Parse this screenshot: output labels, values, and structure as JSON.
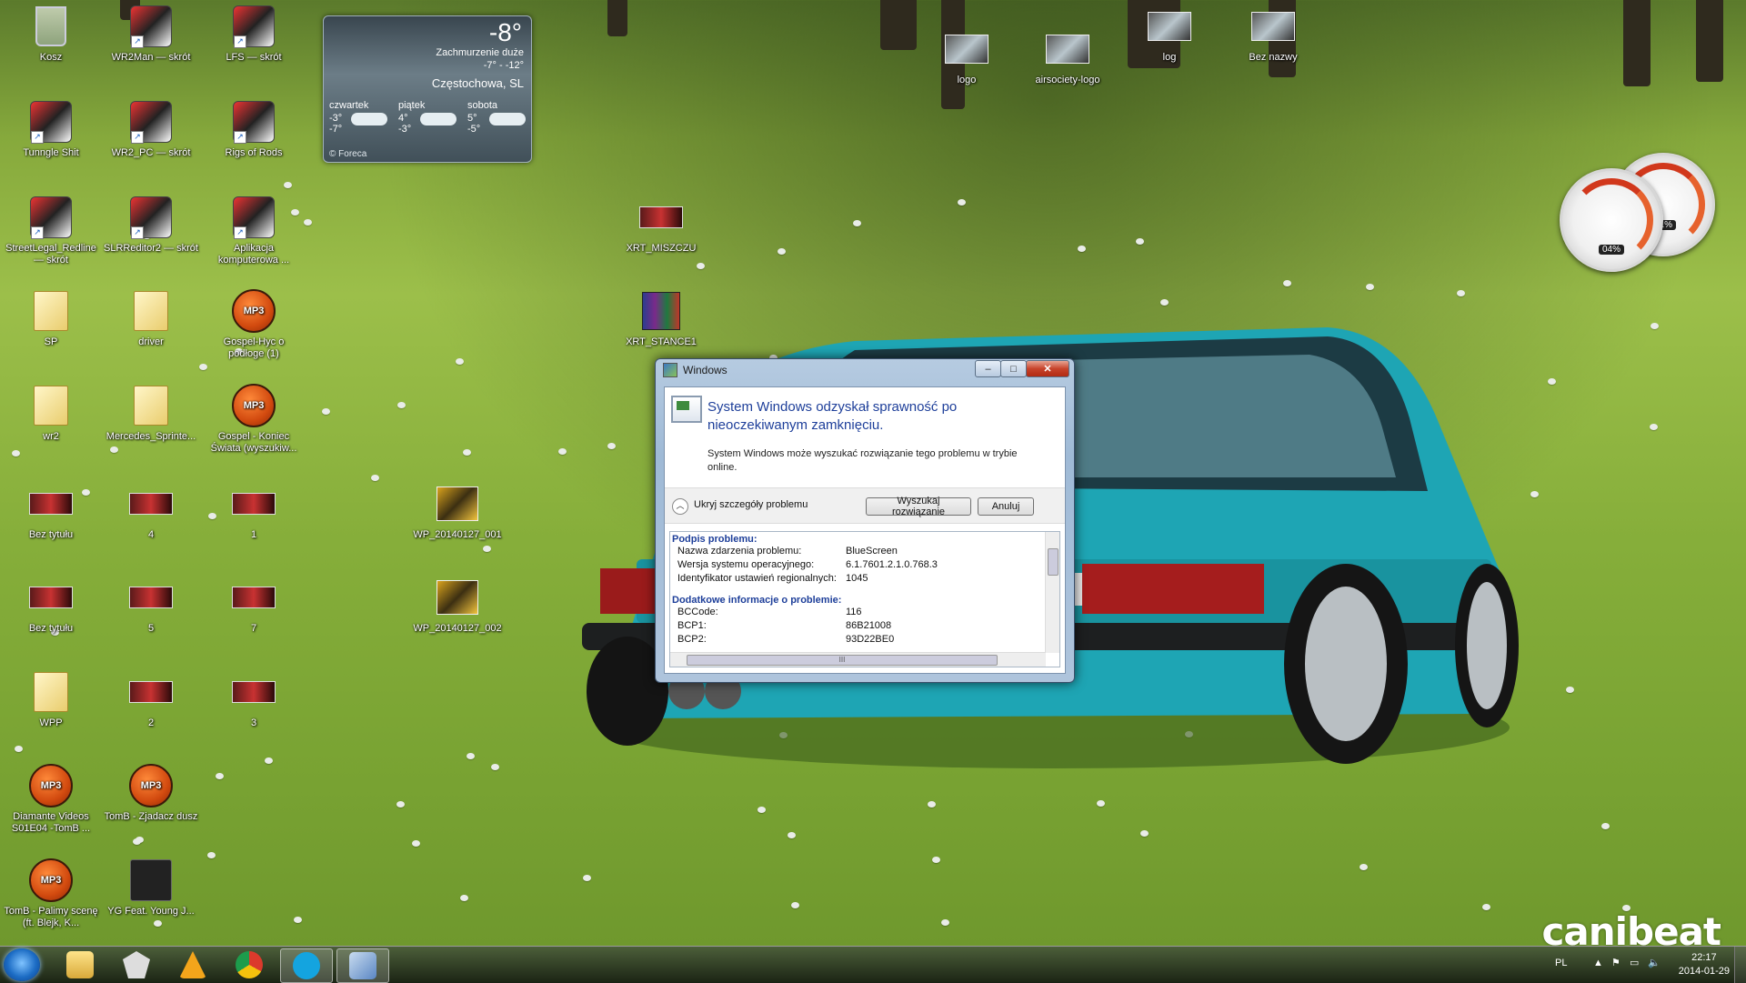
{
  "desktop": {
    "icons": [
      {
        "label": "Kosz",
        "icon": "recycle-bin-icon"
      },
      {
        "label": "WR2Man — skrót",
        "icon": "wr2-icon"
      },
      {
        "label": "LFS — skrót",
        "icon": "lfs-icon"
      },
      {
        "label": "Tunngle Shit",
        "icon": "tunngle-icon"
      },
      {
        "label": "WR2_PC — skrót",
        "icon": "wr2-icon"
      },
      {
        "label": "Rigs of Rods",
        "icon": "rigs-of-rods-icon"
      },
      {
        "label": "StreetLegal_Redline — skrót",
        "icon": "streetlegal-icon"
      },
      {
        "label": "SLRReditor2 — skrót",
        "icon": "slrr-editor-icon"
      },
      {
        "label": "Aplikacja komputerowa ...",
        "icon": "app-icon"
      },
      {
        "label": "SP",
        "icon": "folder-icon"
      },
      {
        "label": "driver",
        "icon": "folder-icon"
      },
      {
        "label": "Gospel-Hyc o podłoge (1)",
        "icon": "mp3-icon"
      },
      {
        "label": "wr2",
        "icon": "folder-icon"
      },
      {
        "label": "Mercedes_Sprinte...",
        "icon": "folder-icon"
      },
      {
        "label": "Gospel - Koniec Świata (wyszukiw...",
        "icon": "mp3-icon"
      },
      {
        "label": "Bez tytułu",
        "icon": "image-icon"
      },
      {
        "label": "4",
        "icon": "image-icon"
      },
      {
        "label": "1",
        "icon": "image-icon"
      },
      {
        "label": "WP_20140127_001",
        "icon": "photo-icon"
      },
      {
        "label": "Bez tytułu",
        "icon": "image-icon"
      },
      {
        "label": "5",
        "icon": "image-icon"
      },
      {
        "label": "7",
        "icon": "image-icon"
      },
      {
        "label": "WP_20140127_002",
        "icon": "photo-icon"
      },
      {
        "label": "WPP",
        "icon": "folder-icon"
      },
      {
        "label": "2",
        "icon": "image-icon"
      },
      {
        "label": "3",
        "icon": "image-icon"
      },
      {
        "label": "Diamante Videos S01E04 -TomB ...",
        "icon": "mp3-icon"
      },
      {
        "label": "TomB - Zjadacz dusz",
        "icon": "mp3-icon"
      },
      {
        "label": "TomB - Palimy scenę (ft. Blejk, K...",
        "icon": "mp3-icon"
      },
      {
        "label": "YG Feat. Young J...",
        "icon": "audio-icon"
      },
      {
        "label": "XRT_MISZCZU",
        "icon": "image-icon"
      },
      {
        "label": "XRT_STANCE1",
        "icon": "archive-icon"
      },
      {
        "label": "logo",
        "icon": "image-icon"
      },
      {
        "label": "airsociety-logo",
        "icon": "image-icon"
      },
      {
        "label": "log",
        "icon": "image-icon"
      },
      {
        "label": "Bez nazwy",
        "icon": "image-icon"
      }
    ]
  },
  "weather": {
    "temp": "-8°",
    "condition": "Zachmurzenie duże",
    "range": "-7° - -12°",
    "city": "Częstochowa, SL",
    "forecast": [
      {
        "day": "czwartek",
        "hi": "-3°",
        "lo": "-7°"
      },
      {
        "day": "piątek",
        "hi": "4°",
        "lo": "-3°"
      },
      {
        "day": "sobota",
        "hi": "5°",
        "lo": "-5°"
      }
    ],
    "source": "© Foreca"
  },
  "gauges": {
    "cpu": "04%",
    "ram": "31%"
  },
  "dialog": {
    "title": "Windows",
    "heading": "System Windows odzyskał sprawność po nieoczekiwanym zamknięciu.",
    "text": "System Windows może wyszukać rozwiązanie tego problemu w trybie online.",
    "toggle_label": "Ukryj szczegóły problemu",
    "search_button": "Wyszukaj rozwiązanie",
    "cancel_button": "Anuluj",
    "section1": "Podpis problemu:",
    "sig_rows": [
      {
        "k": "Nazwa zdarzenia problemu:",
        "v": "BlueScreen"
      },
      {
        "k": "Wersja systemu operacyjnego:",
        "v": "6.1.7601.2.1.0.768.3"
      },
      {
        "k": "Identyfikator ustawień regionalnych:",
        "v": "1045"
      }
    ],
    "section2": "Dodatkowe informacje o problemie:",
    "extra_rows": [
      {
        "k": "BCCode:",
        "v": "116"
      },
      {
        "k": "BCP1:",
        "v": "86B21008"
      },
      {
        "k": "BCP2:",
        "v": "93D22BE0"
      }
    ],
    "scroll_grip": "III"
  },
  "taskbar": {
    "apps": [
      "explorer-icon",
      "foobar-icon",
      "origin-icon",
      "chrome-icon",
      "skype-icon",
      "windows-error-icon"
    ],
    "language": "PL",
    "time": "22:17",
    "date": "2014-01-29"
  },
  "wallpaper": {
    "brand": "canibeat"
  }
}
